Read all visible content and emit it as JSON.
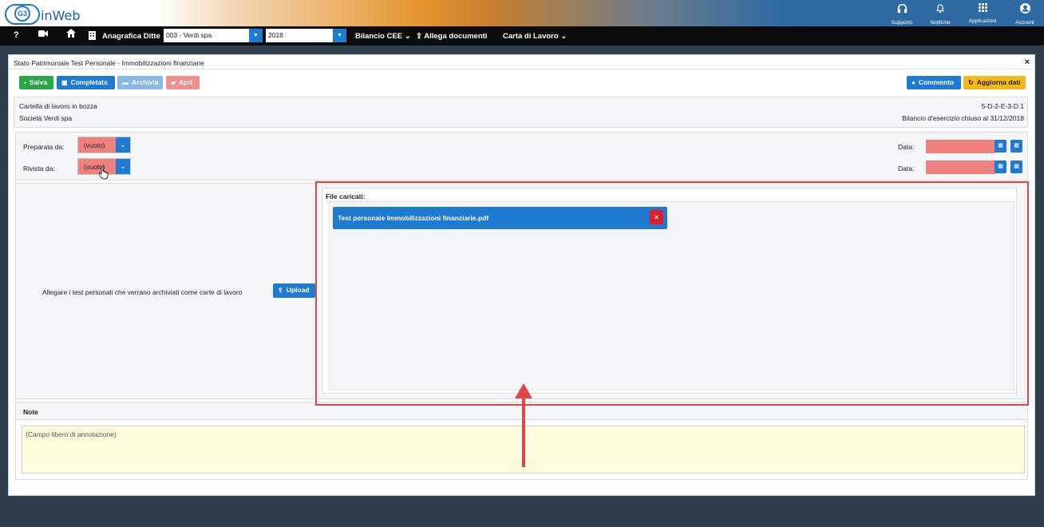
{
  "header": {
    "logo_text": "G3",
    "brand": "inWeb",
    "icons": [
      {
        "icon": "headphones-icon",
        "label": "Supporto"
      },
      {
        "icon": "bell-icon",
        "label": "Notifiche"
      },
      {
        "icon": "grid-icon",
        "label": "Applicazioni"
      },
      {
        "icon": "account-icon",
        "label": "Account"
      }
    ]
  },
  "navbar": {
    "help": "?",
    "anagrafica_label": "Anagrafica Ditte",
    "company_select": "003 - Verdi spa",
    "year_select": "2018",
    "bilancio_label": "Bilancio CEE",
    "allega_label": "Allega documenti",
    "carta_label": "Carta di Lavoro"
  },
  "dialog": {
    "title": "Stato Patrimoniale Test Personale - Immobilizzazioni finanziarie",
    "close": "×",
    "buttons": {
      "salva": "Salva",
      "completata": "Completata",
      "archivia": "Archivia",
      "apri": "Apri",
      "commento": "Commento",
      "aggiorna": "Aggiorna dati"
    },
    "info": {
      "status": "Cartella di lavoro in bozza",
      "company": "Società Verdi spa",
      "code": "5-D-2-E-3-D.1",
      "bilancio": "Bilancio d'esercizio chiuso al 31/12/2018"
    },
    "review": {
      "prepared_label": "Preparata da:",
      "prepared_value": "(vuoto)",
      "reviewed_label": "Rivista da:",
      "reviewed_value": "(vuoto)",
      "date_label_1": "Data:",
      "date_label_2": "Data:"
    },
    "upload": {
      "instructions": "Allegare i test personali che verrano archiviati come carte di lavoro",
      "button": "Upload",
      "files_label": "File caricati:",
      "files": [
        "Test personale Immobilizzazioni finanziarie.pdf"
      ]
    },
    "notes": {
      "title": "Note",
      "placeholder": "(Campo libero di annotazione)"
    }
  },
  "colors": {
    "accent": "#1f7ad1",
    "success": "#28a745",
    "warning": "#f5b81c",
    "danger": "#dc1f2e",
    "empty_field": "#ef8080",
    "annotation": "#e0454a"
  }
}
